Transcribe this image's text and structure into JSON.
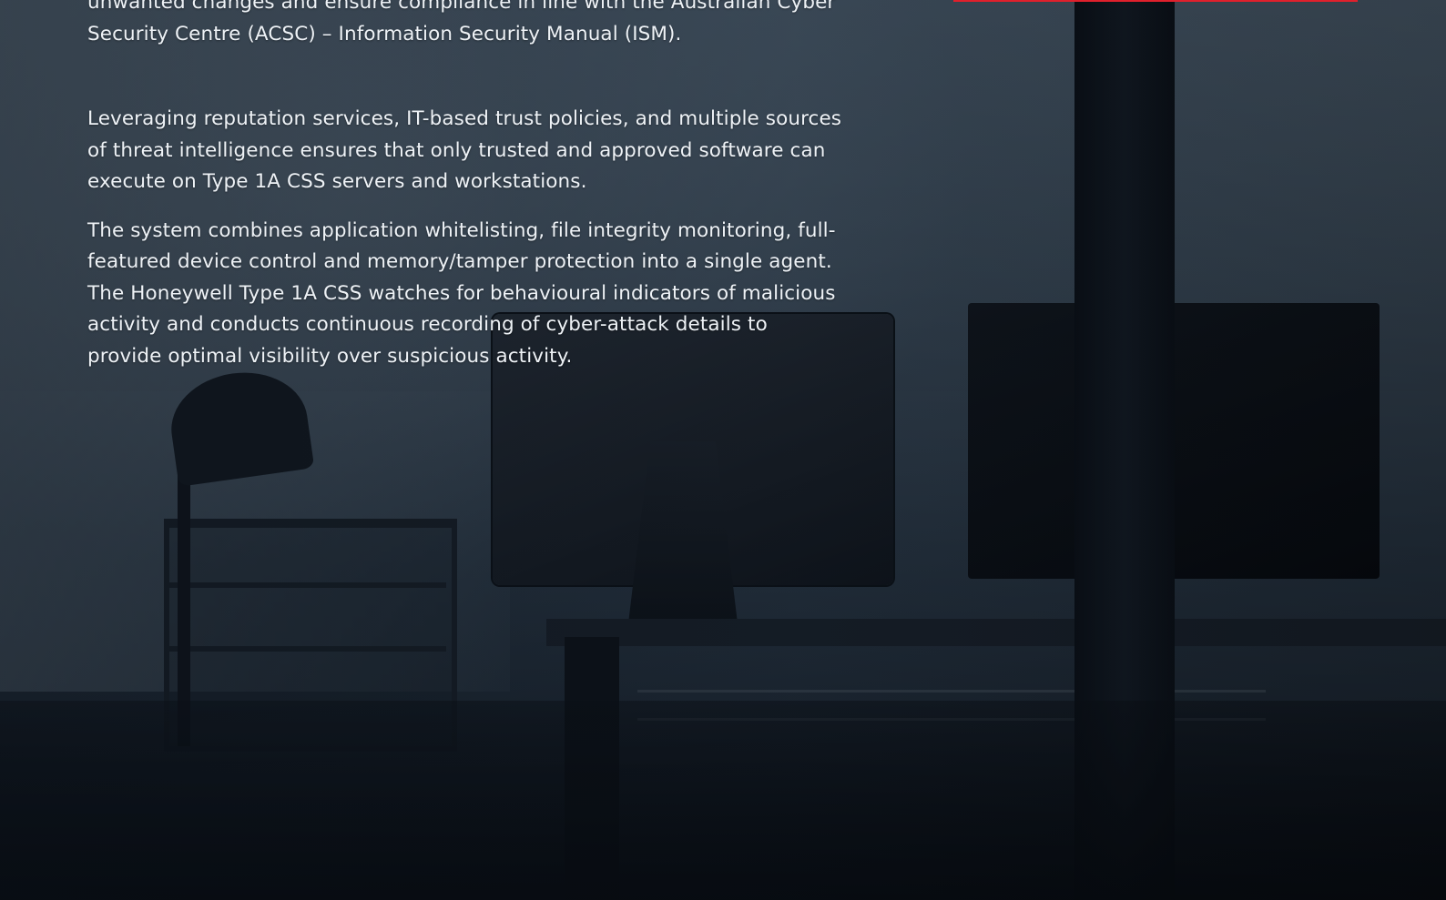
{
  "document": {
    "paragraphs": [
      "unwanted changes and ensure compliance in line with the Australian Cyber Security Centre (ACSC) – Information Security Manual (ISM).",
      "Leveraging reputation services, IT-based trust policies, and multiple sources of threat intelligence ensures that only trusted and approved software can execute on Type 1A CSS servers and workstations.",
      "The system combines application whitelisting, file integrity monitoring, full-featured device control and memory/tamper protection into a single agent. The Honeywell Type 1A CSS watches for behavioural indicators of malicious activity and conducts continuous recording of cyber-attack details to provide optimal visibility over suspicious activity."
    ]
  },
  "colors": {
    "accent_rule": "#e0202c",
    "text": "#eef2f6"
  }
}
